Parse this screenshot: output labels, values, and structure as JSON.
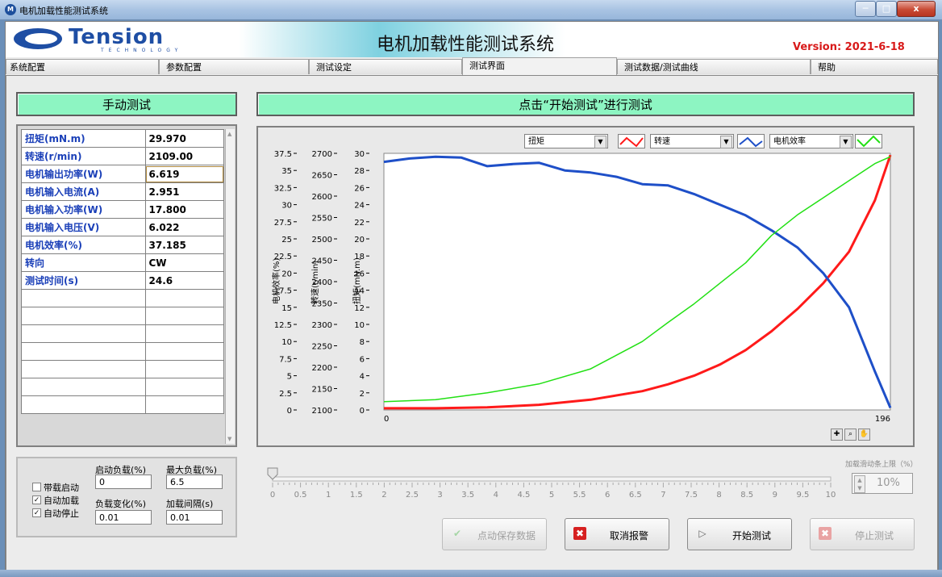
{
  "window": {
    "title": "电机加载性能测试系统",
    "min": "─",
    "max": "□",
    "close": "x"
  },
  "header": {
    "logo_text": "Tension",
    "logo_sub": "TECHNOLOGY",
    "title": "电机加载性能测试系统",
    "version": "Version: 2021-6-18"
  },
  "tabs": [
    "系统配置",
    "参数配置",
    "测试设定",
    "测试界面",
    "测试数据/测试曲线",
    "帮助"
  ],
  "active_tab": "测试界面",
  "manual_test_label": "手动测试",
  "status_banner": "点击“开始测试”进行测试",
  "readings": [
    {
      "label": "扭矩(mN.m)",
      "value": "29.970"
    },
    {
      "label": "转速(r/min)",
      "value": "2109.00"
    },
    {
      "label": "电机输出功率(W)",
      "value": "6.619"
    },
    {
      "label": "电机输入电流(A)",
      "value": "2.951"
    },
    {
      "label": "电机输入功率(W)",
      "value": "17.800"
    },
    {
      "label": "电机输入电压(V)",
      "value": "6.022"
    },
    {
      "label": "电机效率(%)",
      "value": "37.185"
    },
    {
      "label": "转向",
      "value": "CW"
    },
    {
      "label": "测试时间(s)",
      "value": "24.6"
    }
  ],
  "params": {
    "start_load_label": "启动负载(%)",
    "start_load": "0",
    "max_load_label": "最大负载(%)",
    "max_load": "6.5",
    "load_change_label": "负载变化(%)",
    "load_change": "0.01",
    "load_interval_label": "加载间隔(s)",
    "load_interval": "0.01",
    "chk_loaded_start": "带载启动",
    "chk_auto_load": "自动加载",
    "chk_auto_stop": "自动停止",
    "loaded_start": false,
    "auto_load": true,
    "auto_stop": true
  },
  "slider": {
    "value": 0,
    "min": 0,
    "max": 10,
    "ticks": [
      "0",
      "0.5",
      "1",
      "1.5",
      "2",
      "2.5",
      "3",
      "3.5",
      "4",
      "4.5",
      "5",
      "5.5",
      "6",
      "6.5",
      "7",
      "7.5",
      "8",
      "8.5",
      "9",
      "9.5",
      "10"
    ]
  },
  "load_limit": {
    "label": "加载滑动条上限（%）",
    "value": "10%"
  },
  "buttons": {
    "save": "点动保存数据",
    "cancel_alarm": "取消报警",
    "start": "开始测试",
    "stop": "停止测试"
  },
  "colors": {
    "torque": "#ff1a1a",
    "speed": "#1e4fc8",
    "efficiency": "#22e014",
    "mint": "#8df5c2"
  },
  "chart_data": {
    "type": "line",
    "xlim": [
      0,
      196
    ],
    "x_ticks": [
      "0",
      "196"
    ],
    "legend": [
      {
        "name": "扭矩",
        "color": "#ff1a1a"
      },
      {
        "name": "转速",
        "color": "#1e4fc8"
      },
      {
        "name": "电机效率",
        "color": "#22e014"
      }
    ],
    "axes": [
      {
        "label": "电机效率(%)",
        "ylim": [
          0,
          37.5
        ],
        "ticks": [
          "0",
          "2.5",
          "5",
          "7.5",
          "10",
          "12.5",
          "15",
          "17.5",
          "20",
          "22.5",
          "25",
          "27.5",
          "30",
          "32.5",
          "35",
          "37.5"
        ]
      },
      {
        "label": "转速(r/min)",
        "ylim": [
          2100,
          2700
        ],
        "ticks": [
          "2100",
          "2150",
          "2200",
          "2250",
          "2300",
          "2350",
          "2400",
          "2450",
          "2500",
          "2550",
          "2600",
          "2650",
          "2700"
        ]
      },
      {
        "label": "扭矩(mN.m)",
        "ylim": [
          0,
          30
        ],
        "ticks": [
          "0",
          "2",
          "4",
          "6",
          "8",
          "10",
          "12",
          "14",
          "16",
          "18",
          "20",
          "22",
          "24",
          "26",
          "28",
          "30"
        ]
      }
    ],
    "series": [
      {
        "name": "扭矩",
        "axis": 2,
        "x": [
          0,
          20,
          40,
          60,
          80,
          100,
          110,
          120,
          130,
          140,
          150,
          160,
          170,
          180,
          190,
          196
        ],
        "values": [
          0.2,
          0.2,
          0.3,
          0.6,
          1.2,
          2.2,
          3.0,
          4.0,
          5.3,
          7.0,
          9.2,
          11.8,
          14.8,
          18.5,
          24.5,
          29.8
        ]
      },
      {
        "name": "转速",
        "axis": 1,
        "x": [
          0,
          10,
          20,
          30,
          40,
          50,
          60,
          70,
          80,
          90,
          100,
          110,
          120,
          130,
          140,
          150,
          160,
          170,
          180,
          190,
          196
        ],
        "values": [
          2680,
          2688,
          2692,
          2690,
          2670,
          2675,
          2678,
          2660,
          2655,
          2645,
          2628,
          2625,
          2605,
          2580,
          2555,
          2520,
          2480,
          2420,
          2340,
          2190,
          2105
        ]
      },
      {
        "name": "电机效率",
        "axis": 0,
        "x": [
          0,
          20,
          40,
          60,
          80,
          100,
          110,
          120,
          130,
          140,
          150,
          160,
          170,
          180,
          190,
          196
        ],
        "values": [
          1.2,
          1.5,
          2.5,
          3.8,
          6.0,
          10.0,
          12.8,
          15.5,
          18.5,
          21.5,
          25.5,
          28.5,
          31.0,
          33.5,
          36.0,
          37.0
        ]
      }
    ]
  }
}
